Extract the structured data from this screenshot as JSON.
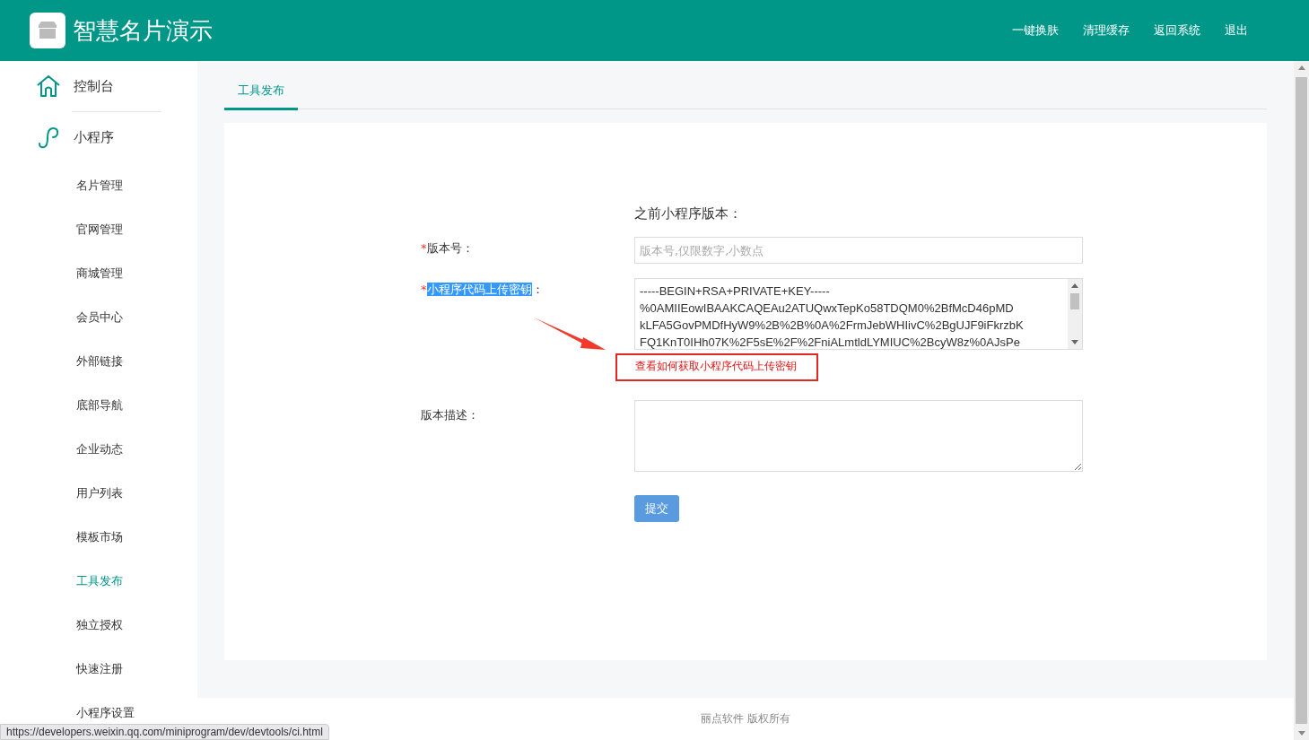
{
  "header": {
    "title": "智慧名片演示",
    "links": [
      "一键换肤",
      "清理缓存",
      "返回系统",
      "退出"
    ]
  },
  "sidebar": {
    "top_items": [
      {
        "label": "控制台",
        "kind": "home"
      },
      {
        "label": "小程序",
        "kind": "mini"
      }
    ],
    "items": [
      {
        "label": "名片管理",
        "selected": false
      },
      {
        "label": "官网管理",
        "selected": false
      },
      {
        "label": "商城管理",
        "selected": false
      },
      {
        "label": "会员中心",
        "selected": false
      },
      {
        "label": "外部链接",
        "selected": false
      },
      {
        "label": "底部导航",
        "selected": false
      },
      {
        "label": "企业动态",
        "selected": false
      },
      {
        "label": "用户列表",
        "selected": false
      },
      {
        "label": "模板市场",
        "selected": false
      },
      {
        "label": "工具发布",
        "selected": true
      },
      {
        "label": "独立授权",
        "selected": false
      },
      {
        "label": "快速注册",
        "selected": false
      },
      {
        "label": "小程序设置",
        "selected": false
      }
    ]
  },
  "tabs": [
    {
      "label": "工具发布",
      "selected": true
    }
  ],
  "form": {
    "previous_version_label": "之前小程序版本：",
    "required_mark": "*",
    "colon": "：",
    "fields": [
      {
        "kind": "input",
        "label": "版本号",
        "required": true,
        "text_selected": false,
        "placeholder": "版本号,仅限数字,小数点"
      },
      {
        "kind": "key",
        "label": "小程序代码上传密钥",
        "required": true,
        "text_selected": true,
        "value_lines": [
          "-----BEGIN+RSA+PRIVATE+KEY-----",
          "%0AMIIEowIBAAKCAQEAu2ATUQwxTepKo58TDQM0%2BfMcD46pMD",
          "kLFA5GovPMDfHyW9%2B%2B%0A%2FrmJebWHIivC%2BgUJF9iFkrzbK",
          "FQ1KnT0IHh07K%2F5sE%2F%2FniALmtldLYMIUC%2BcyW8z%0AJsPe"
        ],
        "help_link": "查看如何获取小程序代码上传密钥"
      },
      {
        "kind": "textarea",
        "label": "版本描述",
        "required": false,
        "text_selected": false
      }
    ],
    "submit": "提交"
  },
  "footer": "丽点软件 版权所有",
  "status_url": "https://developers.weixin.qq.com/miniprogram/dev/devtools/ci.html"
}
